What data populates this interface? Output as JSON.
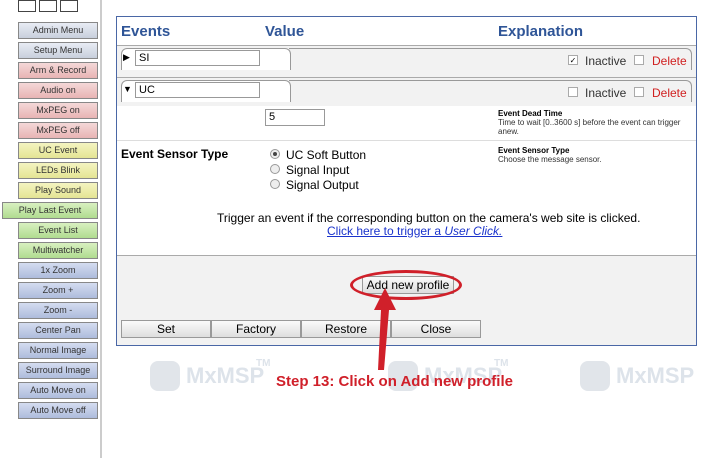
{
  "sidebar": {
    "items": [
      {
        "label": "Admin Menu",
        "color": "grey"
      },
      {
        "label": "Setup Menu",
        "color": "grey"
      },
      {
        "label": "Arm & Record",
        "color": "pink"
      },
      {
        "label": "Audio on",
        "color": "pink"
      },
      {
        "label": "MxPEG on",
        "color": "pink"
      },
      {
        "label": "MxPEG off",
        "color": "pink"
      },
      {
        "label": "UC Event",
        "color": "yellow"
      },
      {
        "label": "LEDs Blink",
        "color": "yellow"
      },
      {
        "label": "Play Sound",
        "color": "yellow"
      },
      {
        "label": "Play Last Event",
        "color": "green"
      },
      {
        "label": "Event List",
        "color": "green"
      },
      {
        "label": "Multiwatcher",
        "color": "green"
      },
      {
        "label": "1x Zoom",
        "color": "blue"
      },
      {
        "label": "Zoom +",
        "color": "blue"
      },
      {
        "label": "Zoom -",
        "color": "blue"
      },
      {
        "label": "Center Pan",
        "color": "blue"
      },
      {
        "label": "Normal Image",
        "color": "blue"
      },
      {
        "label": "Surround Image",
        "color": "blue"
      },
      {
        "label": "Auto Move on",
        "color": "blue"
      },
      {
        "label": "Auto Move off",
        "color": "blue"
      }
    ]
  },
  "header": {
    "events": "Events",
    "value": "Value",
    "explanation": "Explanation"
  },
  "events": [
    {
      "name": "SI",
      "inactive_label": "Inactive",
      "delete_label": "Delete",
      "inactive_checked": true
    },
    {
      "name": "UC",
      "inactive_label": "Inactive",
      "delete_label": "Delete",
      "inactive_checked": false
    }
  ],
  "dead_time": {
    "value": "5",
    "title": "Event Dead Time",
    "desc": "Time to wait [0..3600 s] before the event can trigger anew."
  },
  "sensor": {
    "label": "Event Sensor Type",
    "options": [
      "UC Soft Button",
      "Signal Input",
      "Signal Output"
    ],
    "selected": "UC Soft Button",
    "title": "Event Sensor Type",
    "desc": "Choose the message sensor."
  },
  "trigger": {
    "note": "Trigger an event if the corresponding button on the camera's web site is clicked.",
    "link_prefix": "Click here to trigger a ",
    "link_italic": "User Click."
  },
  "buttons": {
    "add_profile": "Add new profile",
    "set": "Set",
    "factory": "Factory",
    "restore": "Restore",
    "close": "Close"
  },
  "watermark": {
    "text": "MxMSP",
    "tm": "TM"
  },
  "annotation": {
    "step": "Step 13: Click on Add new profile",
    "color": "#d0202a"
  }
}
